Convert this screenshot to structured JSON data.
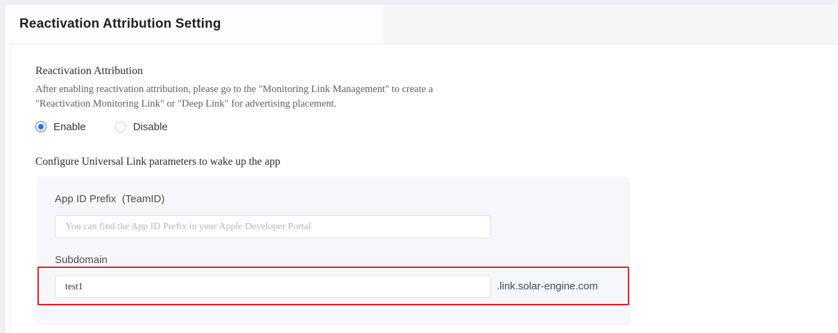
{
  "page": {
    "title": "Reactivation Attribution Setting"
  },
  "reactivation_section": {
    "heading": "Reactivation Attribution",
    "description": "After enabling reactivation attribution, please go to the \"Monitoring Link Management\" to create a \"Reactivation Monitoring Link\" or \"Deep Link\" for advertising placement.",
    "options": [
      {
        "label": "Enable",
        "selected": true
      },
      {
        "label": "Disable",
        "selected": false
      }
    ]
  },
  "universal_link": {
    "heading": "Configure Universal Link parameters to wake up the app",
    "app_id_prefix": {
      "label": "App ID Prefix  (TeamID)",
      "placeholder": "You can find the App ID Prefix in your Apple Developer Portal",
      "value": ""
    },
    "subdomain": {
      "label": "Subdomain",
      "value": "test1",
      "suffix": ".link.solar-engine.com"
    }
  },
  "colors": {
    "accent": "#2670e8",
    "highlight_border": "#ea1b22",
    "panel_bg": "#f5f7fa"
  }
}
